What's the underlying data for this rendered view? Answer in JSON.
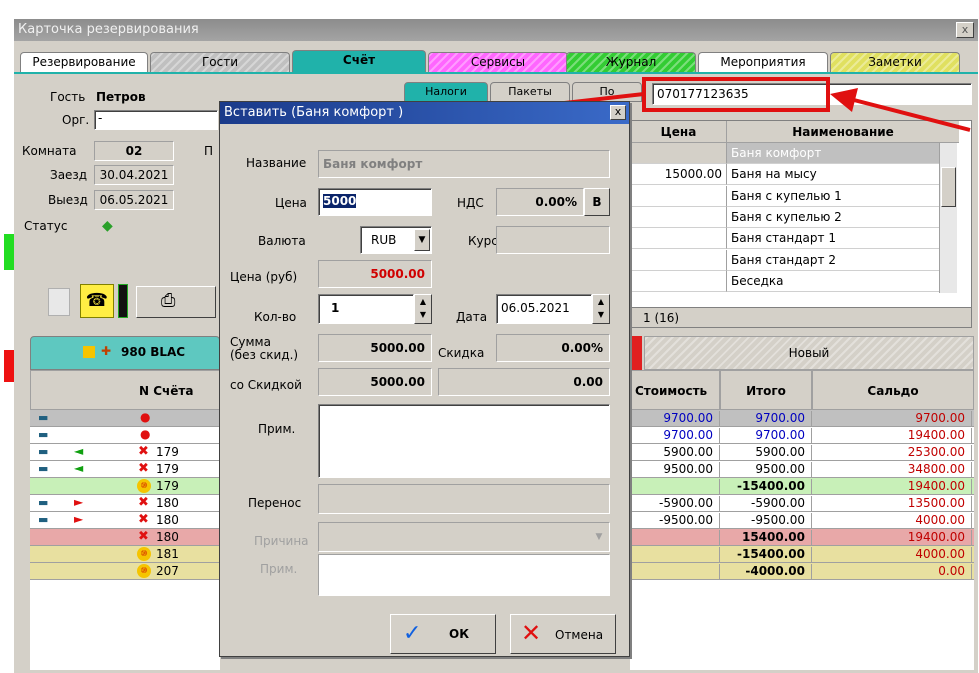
{
  "window": {
    "title": "Карточка резервирования",
    "close": "x"
  },
  "tabs": [
    {
      "label": "Резервирование",
      "color": "#ffffff"
    },
    {
      "label": "Гости",
      "color": "#c0c0c0"
    },
    {
      "label": "Счёт",
      "color": "#20b2aa"
    },
    {
      "label": "Сервисы",
      "color": "#ff66ff"
    },
    {
      "label": "Журнал",
      "color": "#33cc33"
    },
    {
      "label": "Мероприятия",
      "color": "#ffffff"
    },
    {
      "label": "Заметки",
      "color": "#e0e060"
    }
  ],
  "guest": {
    "guest_label": "Гость",
    "guest_value": "Петров",
    "org_label": "Орг.",
    "org_value": "-",
    "room_label": "Комната",
    "room_value": "02",
    "room_extra": "П",
    "arrival_label": "Заезд",
    "arrival_value": "30.04.2021",
    "departure_label": "Выезд",
    "departure_value": "06.05.2021",
    "status_label": "Статус"
  },
  "subtabs": [
    "Налоги",
    "Пакеты",
    "По"
  ],
  "search_value": "070177123635",
  "services_table": {
    "headers": [
      "Цена",
      "Наименование"
    ],
    "rows": [
      {
        "price": "",
        "name": "Баня комфорт",
        "selected": true
      },
      {
        "price": "15000.00",
        "name": "Баня на мысу"
      },
      {
        "price": "",
        "name": "Баня с купелью 1"
      },
      {
        "price": "",
        "name": "Баня с купелью 2"
      },
      {
        "price": "",
        "name": "Баня стандарт 1"
      },
      {
        "price": "",
        "name": "Баня стандарт 2"
      },
      {
        "price": "",
        "name": "Беседка"
      }
    ],
    "counter": "1 (16)"
  },
  "account_bar": {
    "label": "980 BLAC",
    "new_label": "Новый"
  },
  "account_table": {
    "headers": [
      "N Счёта",
      "Стоимость",
      "Итого",
      "Сальдо"
    ],
    "rows": [
      {
        "num": "",
        "cost": "9700.00",
        "total": "9700.00",
        "balance": "9700.00",
        "bg": "#c0c0c0",
        "mark": "dot"
      },
      {
        "num": "",
        "cost": "9700.00",
        "total": "9700.00",
        "balance": "19400.00",
        "bg": "#ffffff",
        "mark": "dot"
      },
      {
        "num": "179",
        "cost": "5900.00",
        "total": "5900.00",
        "balance": "25300.00",
        "bg": "#ffffff",
        "mark": "x",
        "arrow": "left"
      },
      {
        "num": "179",
        "cost": "9500.00",
        "total": "9500.00",
        "balance": "34800.00",
        "bg": "#ffffff",
        "mark": "x",
        "arrow": "left"
      },
      {
        "num": "179",
        "cost": "",
        "total": "-15400.00",
        "balance": "19400.00",
        "bg": "#c8f0b8",
        "mark": "10"
      },
      {
        "num": "180",
        "cost": "-5900.00",
        "total": "-5900.00",
        "balance": "13500.00",
        "bg": "#ffffff",
        "mark": "x",
        "arrow": "right"
      },
      {
        "num": "180",
        "cost": "-9500.00",
        "total": "-9500.00",
        "balance": "4000.00",
        "bg": "#ffffff",
        "mark": "x",
        "arrow": "right"
      },
      {
        "num": "180",
        "cost": "",
        "total": "15400.00",
        "balance": "19400.00",
        "bg": "#e8a8a8",
        "mark": "x"
      },
      {
        "num": "181",
        "cost": "",
        "total": "-15400.00",
        "balance": "4000.00",
        "bg": "#e8e0a0",
        "mark": "10"
      },
      {
        "num": "207",
        "cost": "",
        "total": "-4000.00",
        "balance": "0.00",
        "bg": "#e8e0a0",
        "mark": "10"
      }
    ]
  },
  "dialog": {
    "title": "Вставить (Баня комфорт )",
    "name_label": "Название",
    "name_value": "Баня комфорт",
    "price_label": "Цена",
    "price_value": "5000",
    "vat_label": "НДС",
    "vat_value": "0.00%",
    "vat_btn": "В",
    "currency_label": "Валюта",
    "currency_value": "RUB",
    "rate_label": "Курс",
    "rate_value": "",
    "price_rub_label": "Цена (руб)",
    "price_rub_value": "5000.00",
    "qty_label": "Кол-во",
    "qty_value": "1",
    "date_label": "Дата",
    "date_value": "06.05.2021",
    "sum_label": "Сумма\n(без скид.)",
    "sum_value": "5000.00",
    "discount_label": "Скидка",
    "discount_value": "0.00%",
    "with_discount_label": "со Скидкой",
    "with_discount_value": "5000.00",
    "extra_value": "0.00",
    "note_label": "Прим.",
    "transfer_label": "Перенос",
    "reason_label": "Причина",
    "note2_label": "Прим.",
    "ok_label": "ОК",
    "cancel_label": "Отмена"
  }
}
